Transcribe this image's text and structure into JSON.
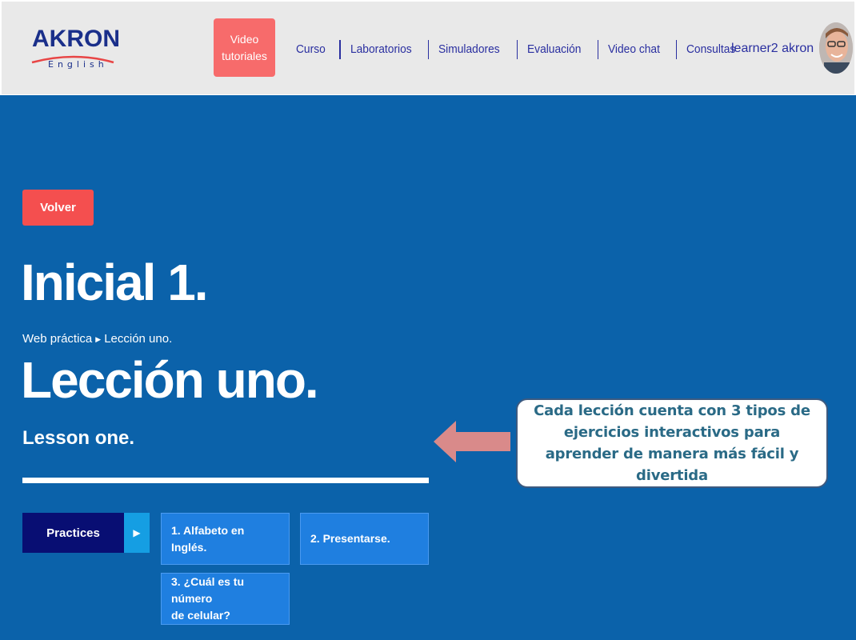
{
  "header": {
    "logo": {
      "name": "AKRON",
      "sub": "English"
    },
    "video_button": {
      "line1": "Video",
      "line2": "tutoriales"
    },
    "nav": [
      "Curso",
      "Laboratorios",
      "Simuladores",
      "Evaluación",
      "Video chat",
      "Consultas"
    ],
    "user": "learner2 akron",
    "avatar_icon": "user-avatar"
  },
  "main": {
    "back_button": "Volver",
    "level_title": "Inicial 1.",
    "breadcrumb": {
      "parent": "Web práctica",
      "current": "Lección uno."
    },
    "lesson_title": "Lección uno.",
    "lesson_subtitle": "Lesson one.",
    "practices_label": "Practices",
    "exercises": [
      {
        "label": "1. Alfabeto en Inglés."
      },
      {
        "label": "2. Presentarse."
      },
      {
        "label_line1": "3. ¿Cuál es tu número",
        "label_line2": "de celular?"
      }
    ]
  },
  "callout": {
    "text": "Cada lección cuenta con 3 tipos de ejercicios interactivos para aprender de manera más fácil y divertida"
  },
  "colors": {
    "header_bg": "#e9e9e9",
    "main_bg": "#0b62aa",
    "accent_red": "#f44f4f",
    "nav_text": "#2a2fa0",
    "practices_bg": "#080e73",
    "card_bg": "#1f7fe0",
    "pointer": "#d98a8a"
  }
}
